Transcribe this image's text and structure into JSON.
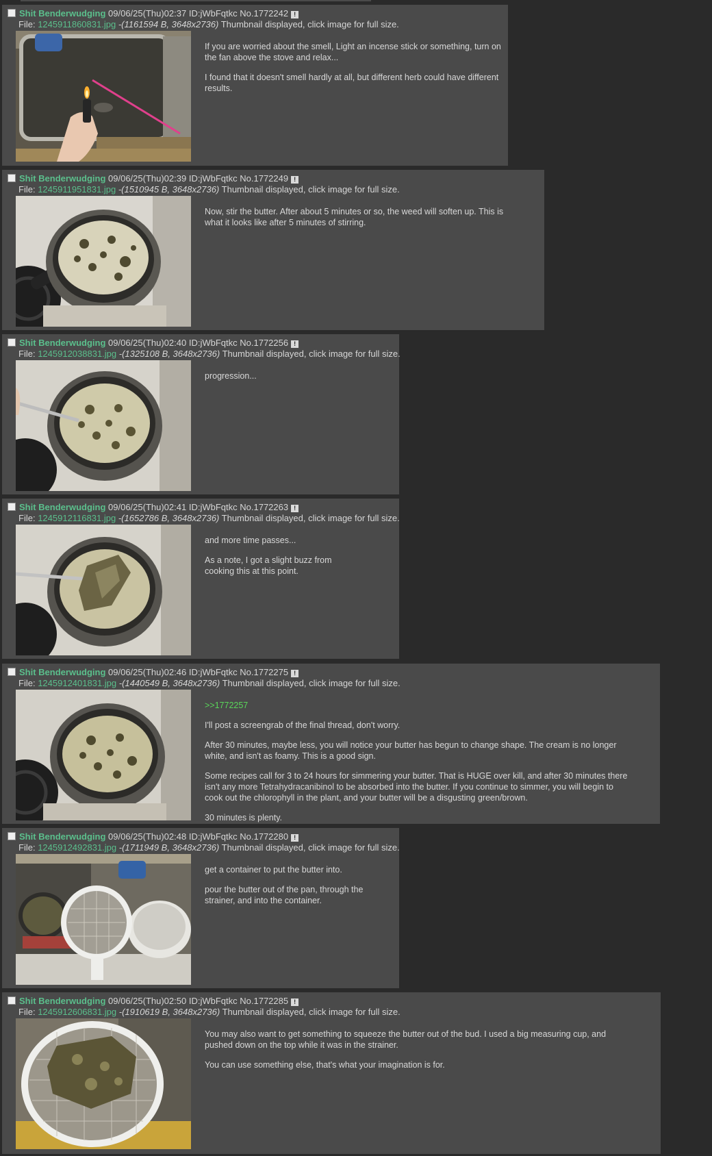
{
  "posts": [
    {
      "name": "Shit Benderwudging",
      "datetime": "09/06/25(Thu)02:37",
      "id": "ID:jWbFqtkc",
      "no": "No.1772242",
      "file_label": "File:",
      "filename": "1245911860831.jpg",
      "filemeta": "-(1161594 B, 3648x2736)",
      "thumb_note": "Thumbnail displayed, click image for full size.",
      "image": "lighter-incense-sink-photo",
      "paragraphs": [
        "If you are worried about the smell, Light an incense stick or something, turn on the fan above the stove and relax...",
        "I found that it doesn't smell hardly at all, but different herb could have different results."
      ]
    },
    {
      "name": "Shit Benderwudging",
      "datetime": "09/06/25(Thu)02:39",
      "id": "ID:jWbFqtkc",
      "no": "No.1772249",
      "file_label": "File:",
      "filename": "1245911951831.jpg",
      "filemeta": "-(1510945 B, 3648x2736)",
      "thumb_note": "Thumbnail displayed, click image for full size.",
      "image": "butter-pan-stove-photo",
      "paragraphs": [
        "Now, stir the butter. After about 5 minutes or so, the weed will soften up. This is what it looks like after 5 minutes of stirring."
      ]
    },
    {
      "name": "Shit Benderwudging",
      "datetime": "09/06/25(Thu)02:40",
      "id": "ID:jWbFqtkc",
      "no": "No.1772256",
      "file_label": "File:",
      "filename": "1245912038831.jpg",
      "filemeta": "-(1325108 B, 3648x2736)",
      "thumb_note": "Thumbnail displayed, click image for full size.",
      "image": "butter-pan-fork-photo",
      "paragraphs": [
        "progression..."
      ]
    },
    {
      "name": "Shit Benderwudging",
      "datetime": "09/06/25(Thu)02:41",
      "id": "ID:jWbFqtkc",
      "no": "No.1772263",
      "file_label": "File:",
      "filename": "1245912116831.jpg",
      "filemeta": "-(1652786 B, 3648x2736)",
      "thumb_note": "Thumbnail displayed, click image for full size.",
      "image": "fork-lifting-herb-photo",
      "paragraphs": [
        "and more time passes...",
        "As a note, I got a slight buzz from cooking this at this point."
      ]
    },
    {
      "name": "Shit Benderwudging",
      "datetime": "09/06/25(Thu)02:46",
      "id": "ID:jWbFqtkc",
      "no": "No.1772275",
      "file_label": "File:",
      "filename": "1245912401831.jpg",
      "filemeta": "-(1440549 B, 3648x2736)",
      "thumb_note": "Thumbnail displayed, click image for full size.",
      "image": "simmering-butter-photo",
      "quote": ">>1772257",
      "paragraphs": [
        "I'll post a screengrab of the final thread, don't worry.",
        "After 30 minutes, maybe less, you will notice your butter has begun to change shape. The cream is no longer white, and isn't as foamy. This is a good sign.",
        "Some recipes call for 3 to 24 hours for simmering your butter. That is HUGE over kill, and after 30 minutes there isn't any more Tetrahydracanibinol to be absorbed into the butter. If you continue to simmer, you will begin to cook out the chlorophyll in the plant, and your butter will be a disgusting green/brown.",
        "30 minutes is plenty."
      ]
    },
    {
      "name": "Shit Benderwudging",
      "datetime": "09/06/25(Thu)02:48",
      "id": "ID:jWbFqtkc",
      "no": "No.1772280",
      "file_label": "File:",
      "filename": "1245912492831.jpg",
      "filemeta": "-(1711949 B, 3648x2736)",
      "thumb_note": "Thumbnail displayed, click image for full size.",
      "image": "strainer-container-photo",
      "paragraphs": [
        "get a container to put the butter into.",
        "pour the butter out of the pan, through the strainer, and into the container."
      ]
    },
    {
      "name": "Shit Benderwudging",
      "datetime": "09/06/25(Thu)02:50",
      "id": "ID:jWbFqtkc",
      "no": "No.1772285",
      "file_label": "File:",
      "filename": "1245912606831.jpg",
      "filemeta": "-(1910619 B, 3648x2736)",
      "thumb_note": "Thumbnail displayed, click image for full size.",
      "image": "strainer-herb-closeup-photo",
      "paragraphs": [
        "You may also want to get something to squeeze the butter out of the bud. I used a big measuring cup, and pushed down on the top while it was in the strainer.",
        "You can use something else, that's what your imagination is for."
      ]
    }
  ],
  "report_glyph": "!",
  "colors": {
    "page_bg": "#2a2a2a",
    "post_bg": "#4a4a4a",
    "name": "#5bbf8c",
    "quotelink": "#5ad65a",
    "text": "#d6d6d6"
  }
}
